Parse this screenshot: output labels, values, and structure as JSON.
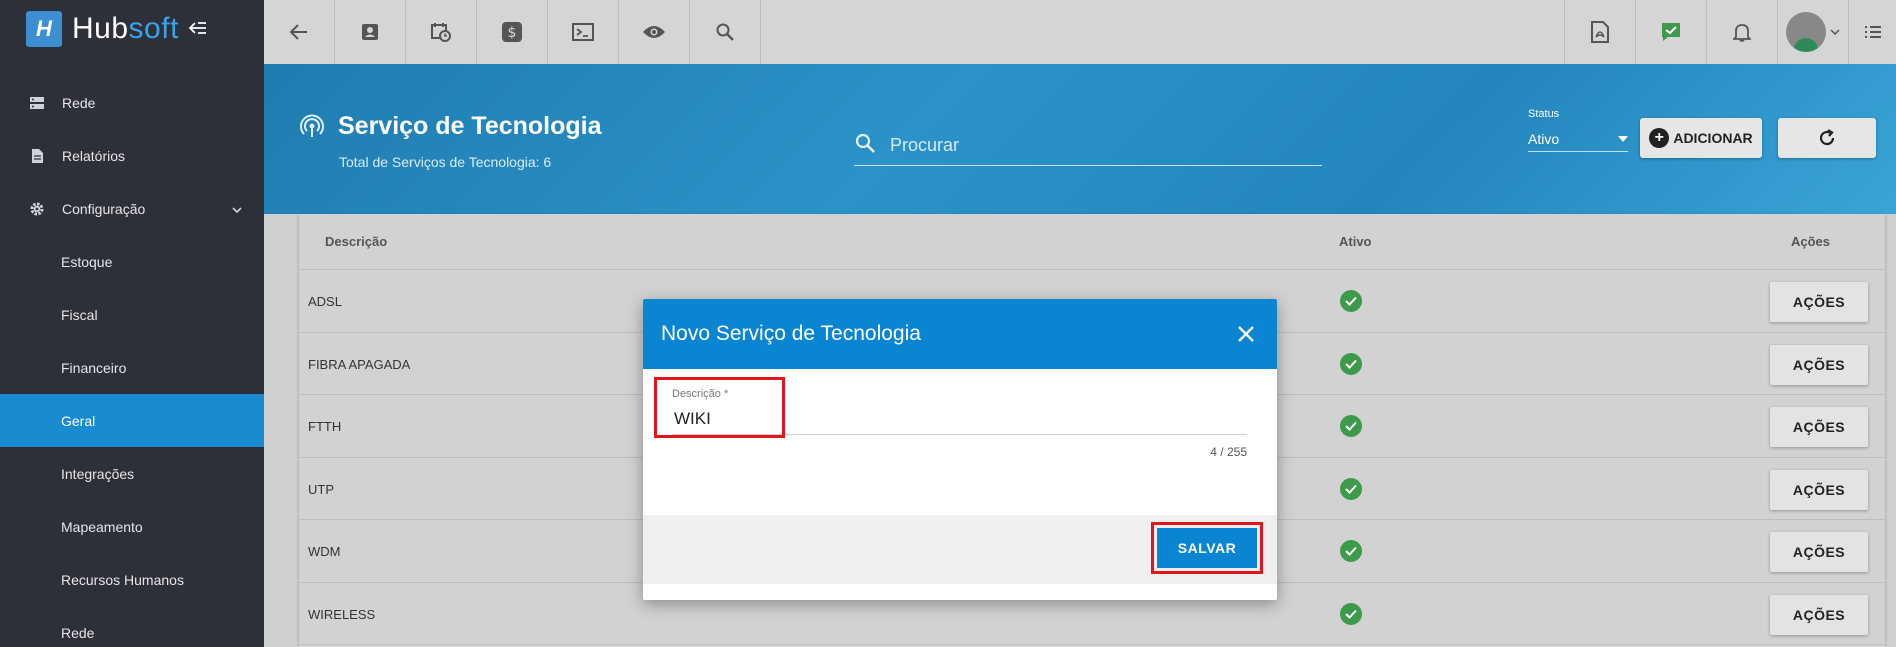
{
  "app": {
    "logo_mark": "H",
    "logo_hub": "Hub",
    "logo_soft": "soft"
  },
  "sidebar": {
    "items": [
      {
        "label": "Rede",
        "icon": "server-icon",
        "type": "top"
      },
      {
        "label": "Relatórios",
        "icon": "document-icon",
        "type": "top"
      },
      {
        "label": "Configuração",
        "icon": "gear-icon",
        "type": "top",
        "expanded": true
      },
      {
        "label": "Estoque",
        "type": "sub"
      },
      {
        "label": "Fiscal",
        "type": "sub"
      },
      {
        "label": "Financeiro",
        "type": "sub"
      },
      {
        "label": "Geral",
        "type": "sub",
        "active": true
      },
      {
        "label": "Integrações",
        "type": "sub"
      },
      {
        "label": "Mapeamento",
        "type": "sub"
      },
      {
        "label": "Recursos Humanos",
        "type": "sub"
      },
      {
        "label": "Rede",
        "type": "sub"
      }
    ]
  },
  "topbar": {
    "left_icons": [
      "back-arrow-icon",
      "contact-card-icon",
      "calendar-clock-icon",
      "dollar-icon",
      "terminal-icon",
      "eye-icon",
      "search-icon"
    ],
    "right_icons": [
      "pdf-icon",
      "chat-check-icon",
      "bell-icon",
      "avatar",
      "menu-list-icon"
    ]
  },
  "header": {
    "title": "Serviço de Tecnologia",
    "subtitle": "Total de Serviços de Tecnologia: 6",
    "search_placeholder": "Procurar",
    "status_label": "Status",
    "status_value": "Ativo",
    "add_label": "ADICIONAR"
  },
  "table": {
    "columns": [
      "Descrição",
      "Ativo",
      "Ações"
    ],
    "rows": [
      {
        "descricao": "ADSL",
        "ativo": true,
        "acoes": "AÇÕES"
      },
      {
        "descricao": "FIBRA APAGADA",
        "ativo": true,
        "acoes": "AÇÕES"
      },
      {
        "descricao": "FTTH",
        "ativo": true,
        "acoes": "AÇÕES"
      },
      {
        "descricao": "UTP",
        "ativo": true,
        "acoes": "AÇÕES"
      },
      {
        "descricao": "WDM",
        "ativo": true,
        "acoes": "AÇÕES"
      },
      {
        "descricao": "WIRELESS",
        "ativo": true,
        "acoes": "AÇÕES"
      }
    ]
  },
  "modal": {
    "title": "Novo Serviço de Tecnologia",
    "field_label": "Descrição *",
    "field_value": "WIKI",
    "counter": "4 / 255",
    "save_label": "SALVAR"
  },
  "colors": {
    "primary": "#0a85d1",
    "sidebar": "#2d3038",
    "highlight": "#e3141b",
    "success": "#3d9a4a"
  }
}
